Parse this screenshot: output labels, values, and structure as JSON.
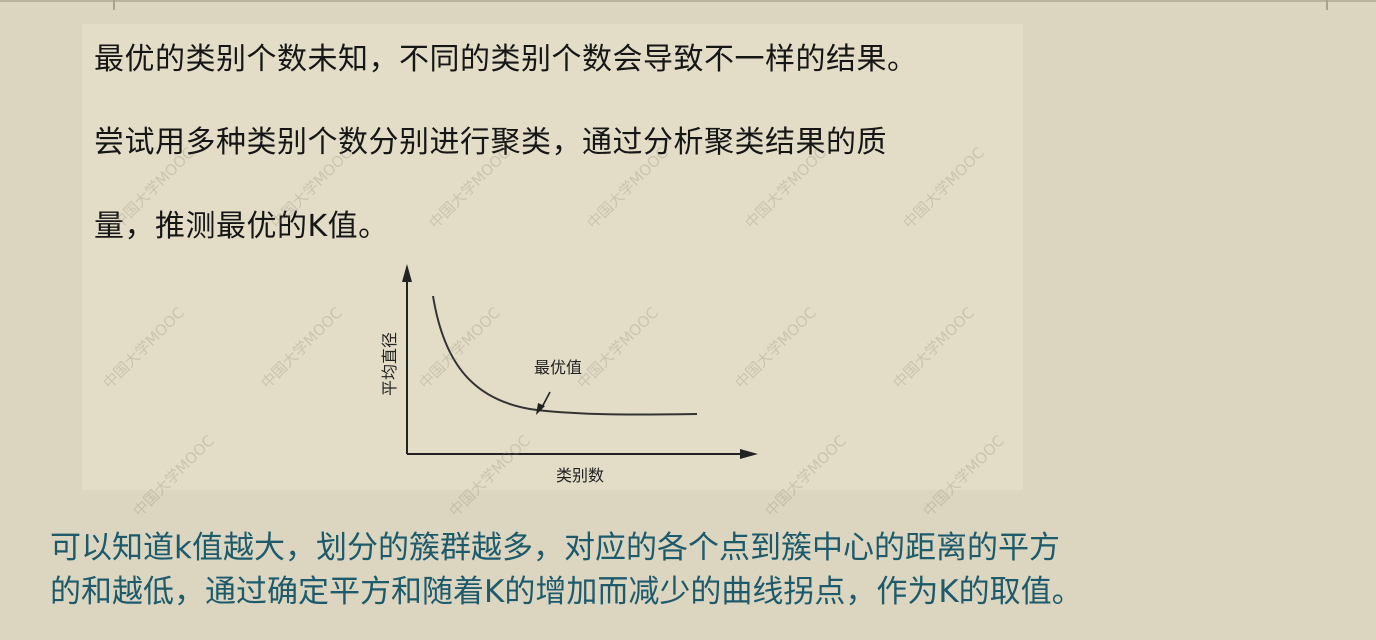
{
  "slide": {
    "image_text": {
      "line1": "最优的类别个数未知，不同的类别个数会导致不一样的结果。",
      "line2": "尝试用多种类别个数分别进行聚类，通过分析聚类结果的质",
      "line3": "量，推测最优的K值。"
    },
    "caption": {
      "line1": "可以知道k值越大，划分的簇群越多，对应的各个点到簇中心的距离的平方",
      "line2": "的和越低，通过确定平方和随着K的增加而减少的曲线拐点，作为K的取值。"
    },
    "watermark_text": "中国大学MOOC"
  },
  "chart_data": {
    "type": "line",
    "xlabel": "类别数",
    "ylabel": "平均直径",
    "annotation": "最优值",
    "shape": "decreasing curve that flattens after an elbow; the annotation arrow points at the elbow",
    "grid": false,
    "colors": {
      "curve": "#333333",
      "axes": "#222222"
    }
  }
}
